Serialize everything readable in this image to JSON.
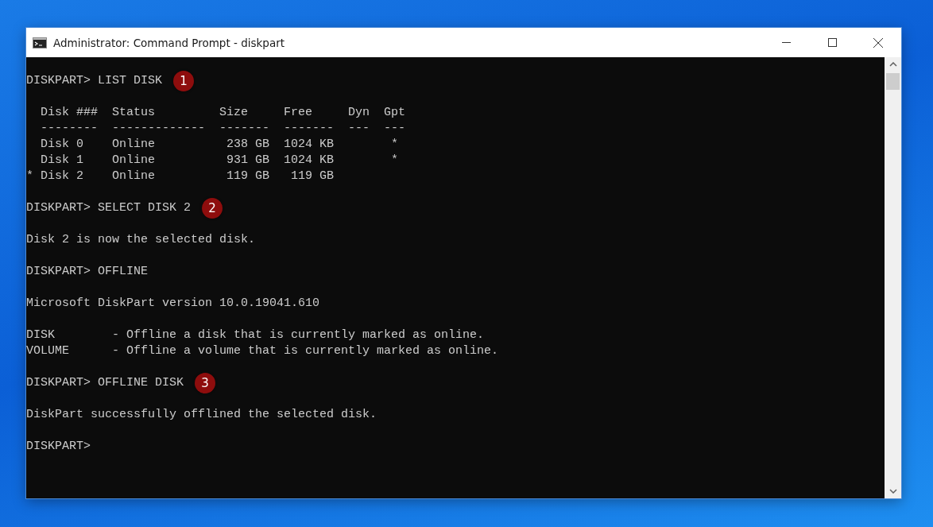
{
  "window": {
    "title": "Administrator: Command Prompt - diskpart"
  },
  "console": {
    "lines": [
      {
        "kind": "text",
        "text": "DISKPART> LIST DISK",
        "badge": "1"
      },
      {
        "kind": "blank"
      },
      {
        "kind": "text",
        "text": "  Disk ###  Status         Size     Free     Dyn  Gpt"
      },
      {
        "kind": "text",
        "text": "  --------  -------------  -------  -------  ---  ---"
      },
      {
        "kind": "text",
        "text": "  Disk 0    Online          238 GB  1024 KB        *"
      },
      {
        "kind": "text",
        "text": "  Disk 1    Online          931 GB  1024 KB        *"
      },
      {
        "kind": "text",
        "text": "* Disk 2    Online          119 GB   119 GB"
      },
      {
        "kind": "blank"
      },
      {
        "kind": "text",
        "text": "DISKPART> SELECT DISK 2",
        "badge": "2"
      },
      {
        "kind": "blank"
      },
      {
        "kind": "text",
        "text": "Disk 2 is now the selected disk."
      },
      {
        "kind": "blank"
      },
      {
        "kind": "text",
        "text": "DISKPART> OFFLINE"
      },
      {
        "kind": "blank"
      },
      {
        "kind": "text",
        "text": "Microsoft DiskPart version 10.0.19041.610"
      },
      {
        "kind": "blank"
      },
      {
        "kind": "text",
        "text": "DISK        - Offline a disk that is currently marked as online."
      },
      {
        "kind": "text",
        "text": "VOLUME      - Offline a volume that is currently marked as online."
      },
      {
        "kind": "blank"
      },
      {
        "kind": "text",
        "text": "DISKPART> OFFLINE DISK",
        "badge": "3"
      },
      {
        "kind": "blank"
      },
      {
        "kind": "text",
        "text": "DiskPart successfully offlined the selected disk."
      },
      {
        "kind": "blank"
      },
      {
        "kind": "text",
        "text": "DISKPART>"
      }
    ]
  }
}
